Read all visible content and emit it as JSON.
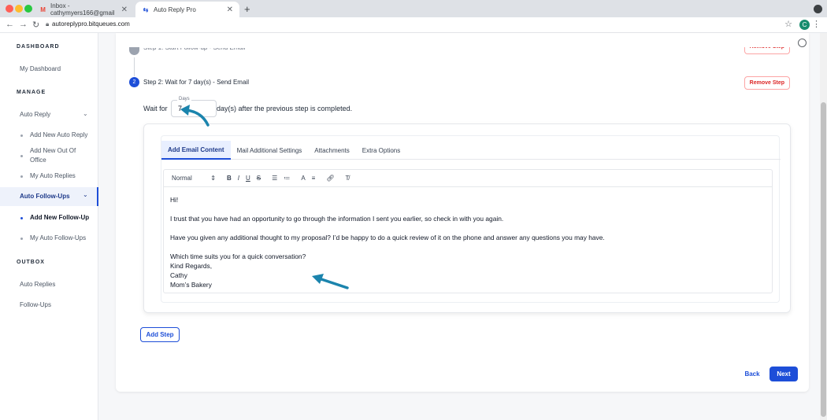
{
  "browser": {
    "tabs": [
      {
        "label": "Inbox - cathymyers166@gmail",
        "icon": "gmail-icon"
      },
      {
        "label": "Auto Reply Pro",
        "icon": "autoreply-icon"
      }
    ],
    "new_tab": "+",
    "url": "autoreplypro.bitqueues.com",
    "avatar_initial": "C"
  },
  "sidebar": {
    "dashboard_header": "DASHBOARD",
    "my_dashboard": "My Dashboard",
    "manage_header": "MANAGE",
    "auto_reply": "Auto Reply",
    "add_new_auto_reply": "Add New Auto Reply",
    "add_new_out_of_office_1": "Add New Out Of",
    "add_new_out_of_office_2": "Office",
    "my_auto_replies": "My Auto Replies",
    "auto_follow_ups": "Auto Follow-Ups",
    "add_new_follow_up": "Add New Follow-Up",
    "my_auto_follow_ups": "My Auto Follow-Ups",
    "outbox_header": "OUTBOX",
    "auto_replies": "Auto Replies",
    "follow_ups": "Follow-Ups"
  },
  "step1": {
    "title": "Step 1: Start Follow-up - Send Email",
    "remove": "Remove Step"
  },
  "step2": {
    "number": "2",
    "title": "Step 2: Wait for 7 day(s) - Send Email",
    "remove": "Remove Step",
    "wait_for": "Wait for",
    "days_label": "Days",
    "days_value": "7",
    "after_text": "day(s) after the previous step is completed."
  },
  "editor": {
    "tabs": [
      "Add Email Content",
      "Mail Additional Settings",
      "Attachments",
      "Extra Options"
    ],
    "format": "Normal",
    "lines": [
      "Hi!",
      "",
      "I trust that you have had an opportunity to go through the information I sent you earlier, so check in with you again.",
      "",
      "Have you given any additional thought to my proposal? I’d be happy to do a quick review of it on the phone and answer any questions you may have.",
      "",
      "Which time suits you for a quick conversation?",
      "Kind Regards,",
      "Cathy",
      "Mom’s Bakery"
    ]
  },
  "actions": {
    "add_step": "Add Step",
    "back": "Back",
    "next": "Next"
  },
  "colors": {
    "primary": "#1d4ed8",
    "danger": "#dc2626",
    "annotation_arrow": "#1b84ad"
  }
}
